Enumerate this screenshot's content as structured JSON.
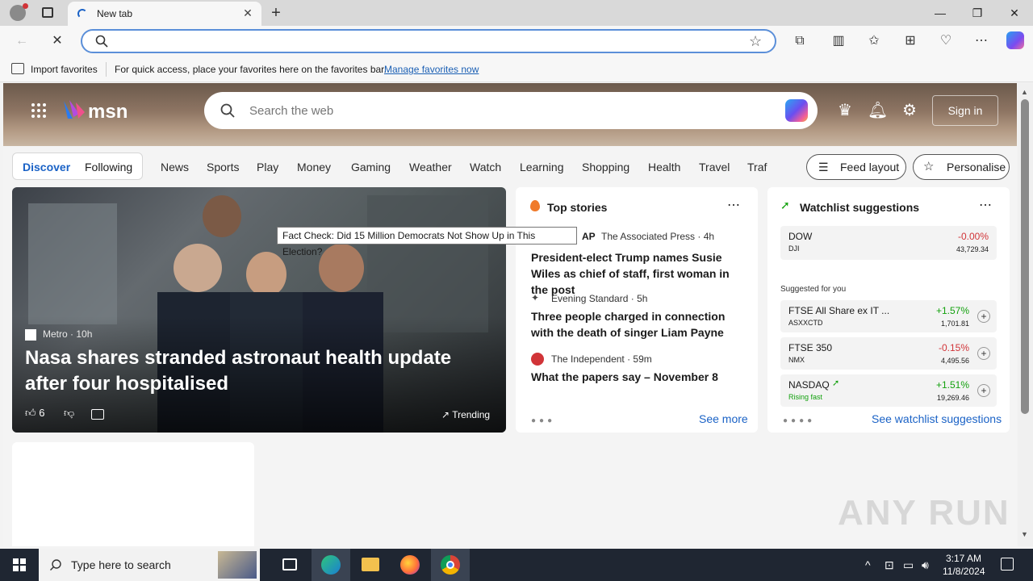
{
  "browser": {
    "tab_title": "New tab",
    "window_controls": {
      "minimize": "—",
      "restore": "❐",
      "close": "✕"
    }
  },
  "favorites_bar": {
    "import_label": "Import favorites",
    "message": "For quick access, place your favorites here on the favorites bar.",
    "manage_link": "Manage favorites now"
  },
  "msn": {
    "logo_text": "msn",
    "search_placeholder": "Search the web",
    "signin_label": "Sign in",
    "segments": [
      "Discover",
      "Following"
    ],
    "nav_items": [
      "News",
      "Sports",
      "Play",
      "Money",
      "Gaming",
      "Weather",
      "Watch",
      "Learning",
      "Shopping",
      "Health",
      "Travel",
      "Traf"
    ],
    "feed_layout_label": "Feed layout",
    "personalise_label": "Personalise"
  },
  "main_story": {
    "source": "Metro",
    "age": "10h",
    "headline": "Nasa shares stranded astronaut health update after four hospitalised",
    "likes": "6",
    "trending_label": "Trending"
  },
  "tooltip": "Fact Check: Did 15 Million Democrats Not Show Up in This Election?",
  "top_stories": {
    "title": "Top stories",
    "items": [
      {
        "source_logo": "AP",
        "source": "The Associated Press · 4h",
        "headline": "President-elect Trump names Susie Wiles as chief of staff, first woman in the post"
      },
      {
        "source": "Evening Standard · 5h",
        "headline": "Three people charged in connection with the death of singer Liam Payne"
      },
      {
        "source": "The Independent · 59m",
        "headline": "What the papers say – November 8"
      }
    ],
    "see_more": "See more"
  },
  "watchlist": {
    "title": "Watchlist suggestions",
    "main": {
      "name": "DOW",
      "symbol": "DJI",
      "change": "-0.00%",
      "price": "43,729.34"
    },
    "suggested_label": "Suggested for you",
    "items": [
      {
        "name": "FTSE All Share ex IT ...",
        "symbol": "ASXXCTD",
        "change": "+1.57%",
        "price": "1,701.81",
        "up": true
      },
      {
        "name": "FTSE 350",
        "symbol": "NMX",
        "change": "-0.15%",
        "price": "4,495.56",
        "up": false
      },
      {
        "name": "NASDAQ",
        "symbol": "Rising fast",
        "change": "+1.51%",
        "price": "19,269.46",
        "up": true
      }
    ],
    "see_link": "See watchlist suggestions"
  },
  "taskbar": {
    "search_placeholder": "Type here to search",
    "time": "3:17 AM",
    "date": "11/8/2024"
  },
  "watermark": "ANY RUN",
  "colors": {
    "accent": "#1a62c6",
    "positive": "#13a10e",
    "negative": "#d13438",
    "taskbar": "#1f2632"
  }
}
